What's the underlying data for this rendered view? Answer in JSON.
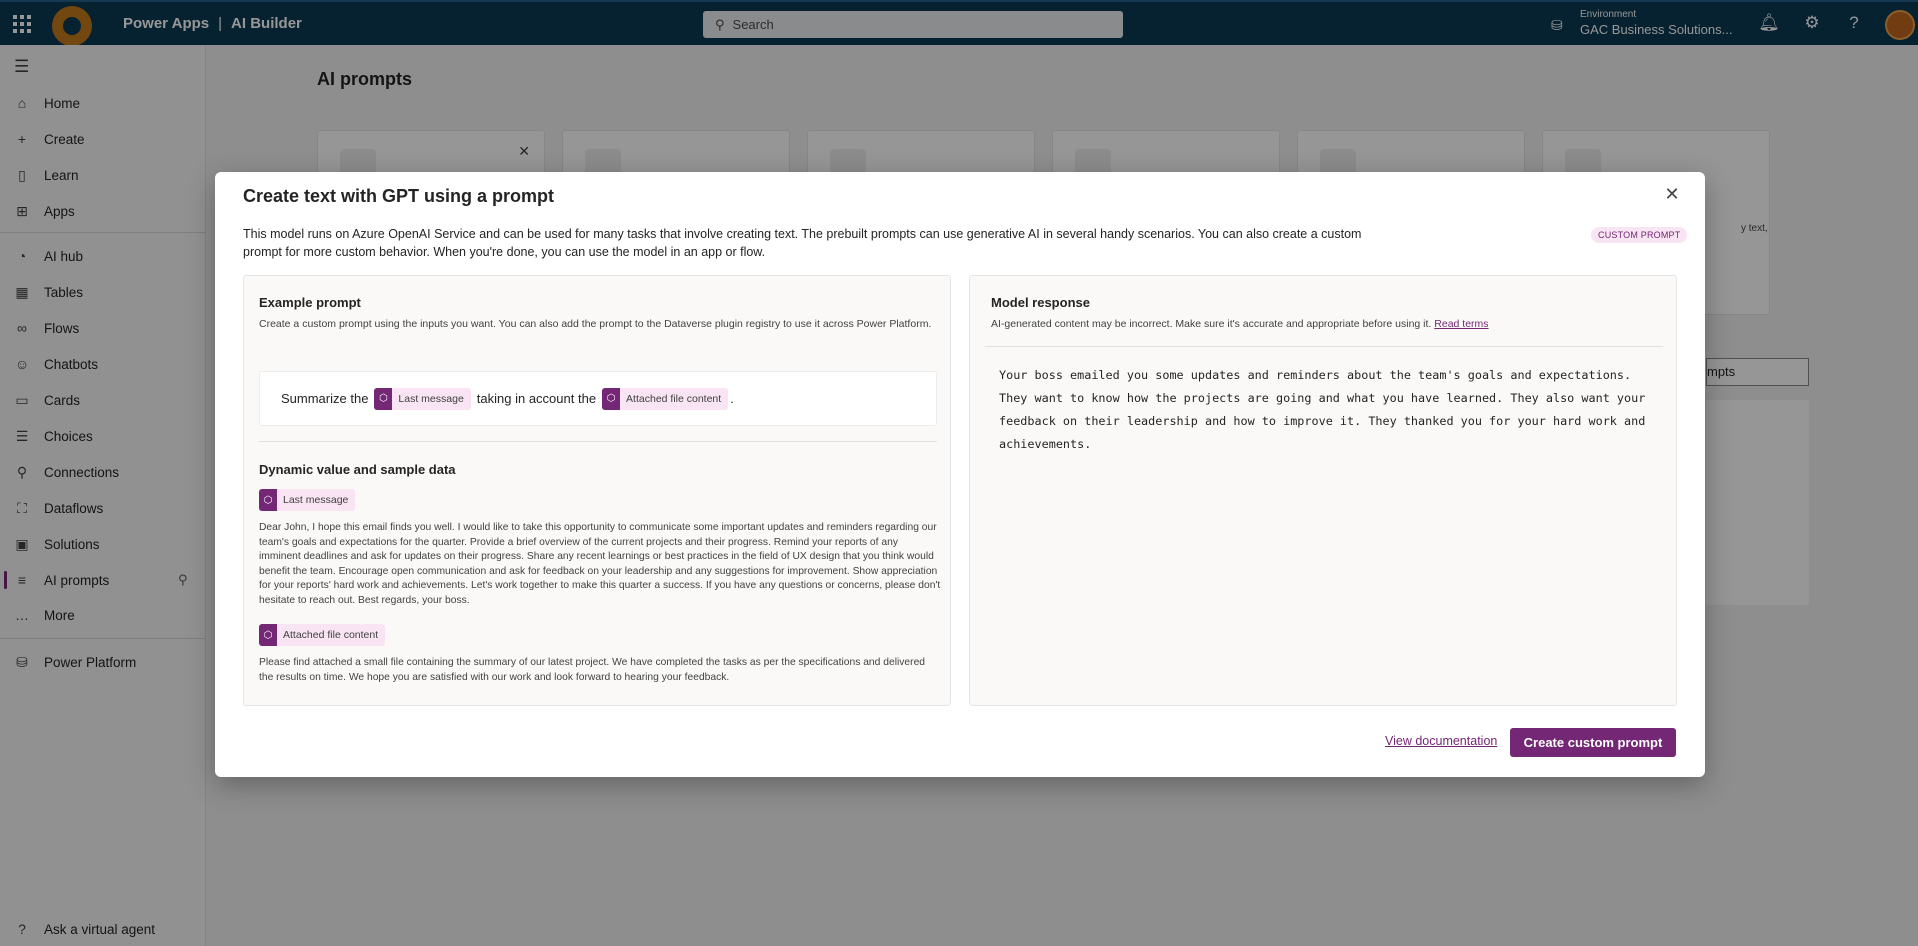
{
  "topbar": {
    "app_name": "Power Apps",
    "separator": "|",
    "module": "AI Builder",
    "search_placeholder": "Search",
    "environment_label": "Environment",
    "environment_name": "GAC Business Solutions..."
  },
  "nav": {
    "items": [
      {
        "label": "Home",
        "icon": "⌂"
      },
      {
        "label": "Create",
        "icon": "+"
      },
      {
        "label": "Learn",
        "icon": "▯"
      },
      {
        "label": "Apps",
        "icon": "⊞"
      },
      {
        "label": "AI hub",
        "icon": "◔"
      },
      {
        "label": "Tables",
        "icon": "▦"
      },
      {
        "label": "Flows",
        "icon": "∞"
      },
      {
        "label": "Chatbots",
        "icon": "☺"
      },
      {
        "label": "Cards",
        "icon": "▭"
      },
      {
        "label": "Choices",
        "icon": "☰"
      },
      {
        "label": "Connections",
        "icon": "⚲"
      },
      {
        "label": "Dataflows",
        "icon": "⛶"
      },
      {
        "label": "Solutions",
        "icon": "▣"
      },
      {
        "label": "AI prompts",
        "icon": "≡"
      },
      {
        "label": "More",
        "icon": "…"
      },
      {
        "label": "Power Platform",
        "icon": "⛁"
      },
      {
        "label": "Ask a virtual agent",
        "icon": "?"
      }
    ]
  },
  "page": {
    "title": "AI prompts",
    "bg_strip_text": "mpts",
    "bg_snippet": "y text,"
  },
  "dialog": {
    "title": "Create text with GPT using a prompt",
    "description": "This model runs on Azure OpenAI Service and can be used for many tasks that involve creating text. The prebuilt prompts can use generative AI in several handy scenarios. You can also create a custom prompt for more custom behavior. When you're done, you can use the model in an app or flow.",
    "badge": "CUSTOM PROMPT",
    "example": {
      "heading": "Example prompt",
      "subtitle": "Create a custom prompt using the inputs you want. You can also add the prompt to the Dataverse plugin registry to use it across Power Platform.",
      "prompt_start": "Summarize the",
      "chip1": "Last message",
      "prompt_mid": "taking in account the",
      "chip2": "Attached file content",
      "prompt_end": "."
    },
    "dynamic": {
      "heading": "Dynamic value and sample data",
      "chip1": "Last message",
      "sample1": "Dear John, I hope this email finds you well. I would like to take this opportunity to communicate some important updates and reminders regarding our team's goals and expectations for the quarter. Provide a brief overview of the current projects and their progress. Remind your reports of any imminent deadlines and ask for updates on their progress. Share any recent learnings or best practices in the field of UX design that you think would benefit the team. Encourage open communication and ask for feedback on your leadership and any suggestions for improvement. Show appreciation for your reports' hard work and achievements. Let's work together to make this quarter a success. If you have any questions or concerns, please don't hesitate to reach out. Best regards, your boss.",
      "chip2": "Attached file content",
      "sample2": "Please find attached a small file containing the summary of our latest project. We have completed the tasks as per the specifications and delivered the results on time. We hope you are satisfied with our work and look forward to hearing your feedback."
    },
    "response": {
      "heading": "Model response",
      "disclaimer": "AI-generated content may be incorrect. Make sure it's accurate and appropriate before using it.",
      "read_terms": "Read terms",
      "text": "Your boss emailed you some updates and reminders about the team's goals and expectations. They want to know how the projects are going and what you have learned. They also want your feedback on their leadership and how to improve it. They thanked you for your hard work and achievements."
    },
    "view_documentation": "View documentation",
    "create_button": "Create custom prompt"
  },
  "colors": {
    "topbar": "#0b3a54",
    "accent": "#742774",
    "chip_bg": "#f8e4f2"
  }
}
